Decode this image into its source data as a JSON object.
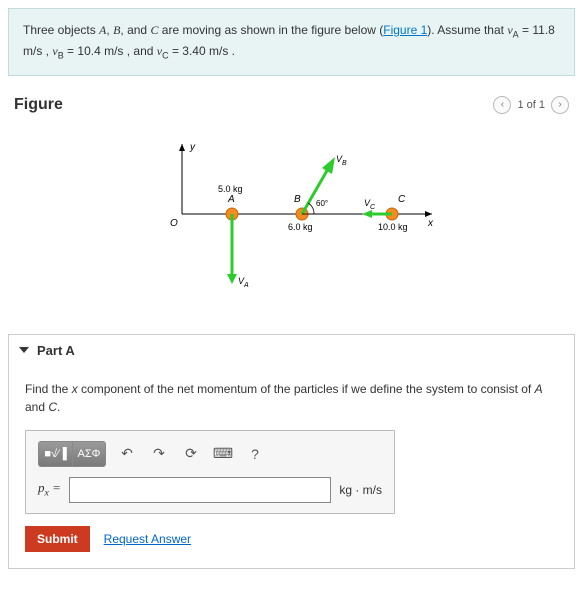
{
  "problem": {
    "intro1": "Three objects ",
    "A": "A",
    "B": "B",
    "C": "C",
    "intro2": ", and ",
    "intro3": " are moving as shown in the figure below (",
    "figlink": "Figure 1",
    "intro4": "). Assume that ",
    "vA_label": "v",
    "vA_sub": "A",
    "eq": " = ",
    "vA_val": "11.8 m/s",
    "vB_label": "v",
    "vB_sub": "B",
    "vB_val": "10.4 m/s",
    "vC_label": "v",
    "vC_sub": "C",
    "vC_val": "3.40 m/s",
    "sep": " , ",
    "and": " , and ",
    "period": " ."
  },
  "figure": {
    "title": "Figure",
    "page": "1 of 1",
    "prev": "‹",
    "next": "›",
    "labels": {
      "y": "y",
      "x": "x",
      "O": "O",
      "A": "A",
      "A_m": "5.0 kg",
      "B": "B",
      "B_m": "6.0 kg",
      "B_ang": "60°",
      "C": "C",
      "C_m": "10.0 kg",
      "vA": "V",
      "vA_sub": "A",
      "vB": "V",
      "vB_sub": "B",
      "vC": "V",
      "vC_sub": "C"
    }
  },
  "partA": {
    "title": "Part A",
    "question1": "Find the ",
    "xcomp": "x",
    "question2": " component of the net momentum of the particles if we define the system to consist of ",
    "and": " and ",
    "period": ".",
    "toolbar": {
      "templates": "■√⁄▐",
      "greek": "ΑΣΦ",
      "undo": "↶",
      "redo": "↷",
      "reset": "⟳",
      "keyboard": "⌨",
      "help": "?"
    },
    "lhs_var": "p",
    "lhs_sub": "x",
    "lhs_eq": " =",
    "units": "kg · m/s",
    "input": "",
    "submit": "Submit",
    "request": "Request Answer"
  }
}
